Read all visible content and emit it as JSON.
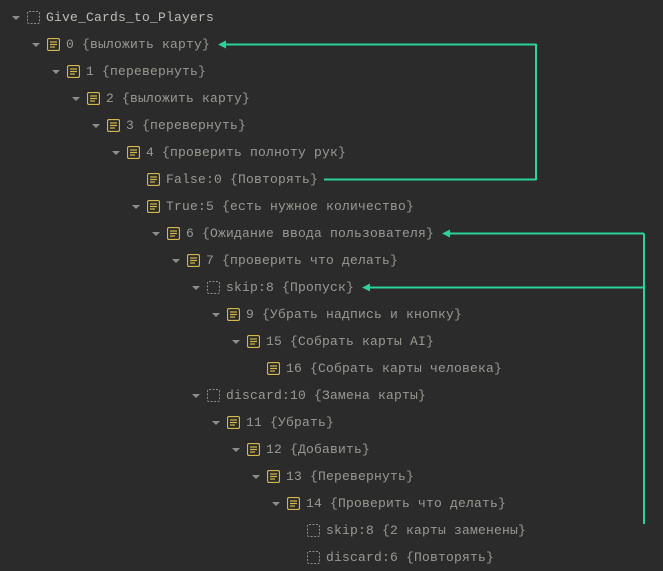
{
  "root_label": "Give_Cards_to_Players",
  "nodes": [
    {
      "indent": 0,
      "arrow": true,
      "icon": "dotted",
      "bind": "root_label",
      "root": true
    },
    {
      "indent": 1,
      "arrow": true,
      "icon": "yellow",
      "text": "0 {выложить карту}"
    },
    {
      "indent": 2,
      "arrow": true,
      "icon": "yellow",
      "text": "1 {перевернуть}"
    },
    {
      "indent": 3,
      "arrow": true,
      "icon": "yellow",
      "text": "2 {выложить карту}"
    },
    {
      "indent": 4,
      "arrow": true,
      "icon": "yellow",
      "text": "3 {перевернуть}"
    },
    {
      "indent": 5,
      "arrow": true,
      "icon": "yellow",
      "text": "4 {проверить полноту рук}"
    },
    {
      "indent": 6,
      "arrow": false,
      "icon": "yellow",
      "text": "False:0 {Повторять}"
    },
    {
      "indent": 6,
      "arrow": true,
      "icon": "yellow",
      "text": "True:5 {есть нужное количество}"
    },
    {
      "indent": 7,
      "arrow": true,
      "icon": "yellow",
      "text": "6 {Ожидание ввода пользователя}"
    },
    {
      "indent": 8,
      "arrow": true,
      "icon": "yellow",
      "text": "7 {проверить что делать}"
    },
    {
      "indent": 9,
      "arrow": true,
      "icon": "dotted",
      "text": "skip:8 {Пропуск}"
    },
    {
      "indent": 10,
      "arrow": true,
      "icon": "yellow",
      "text": "9 {Убрать надпись и кнопку}"
    },
    {
      "indent": 11,
      "arrow": true,
      "icon": "yellow",
      "text": "15 {Собрать карты AI}"
    },
    {
      "indent": 12,
      "arrow": false,
      "icon": "yellow",
      "text": "16 {Собрать карты человека}"
    },
    {
      "indent": 9,
      "arrow": true,
      "icon": "dotted",
      "text": "discard:10 {Замена карты}"
    },
    {
      "indent": 10,
      "arrow": true,
      "icon": "yellow",
      "text": "11 {Убрать}"
    },
    {
      "indent": 11,
      "arrow": true,
      "icon": "yellow",
      "text": "12 {Добавить}"
    },
    {
      "indent": 12,
      "arrow": true,
      "icon": "yellow",
      "text": "13 {Перевернуть}"
    },
    {
      "indent": 13,
      "arrow": true,
      "icon": "yellow",
      "text": "14 {Проверить что делать}"
    },
    {
      "indent": 14,
      "arrow": false,
      "icon": "dotted",
      "text": "skip:8 {2 карты заменены}"
    },
    {
      "indent": 14,
      "arrow": false,
      "icon": "dotted",
      "text": "discard:6 {Повторять}"
    }
  ],
  "colors": {
    "arrow_color": "#2bd39a"
  }
}
